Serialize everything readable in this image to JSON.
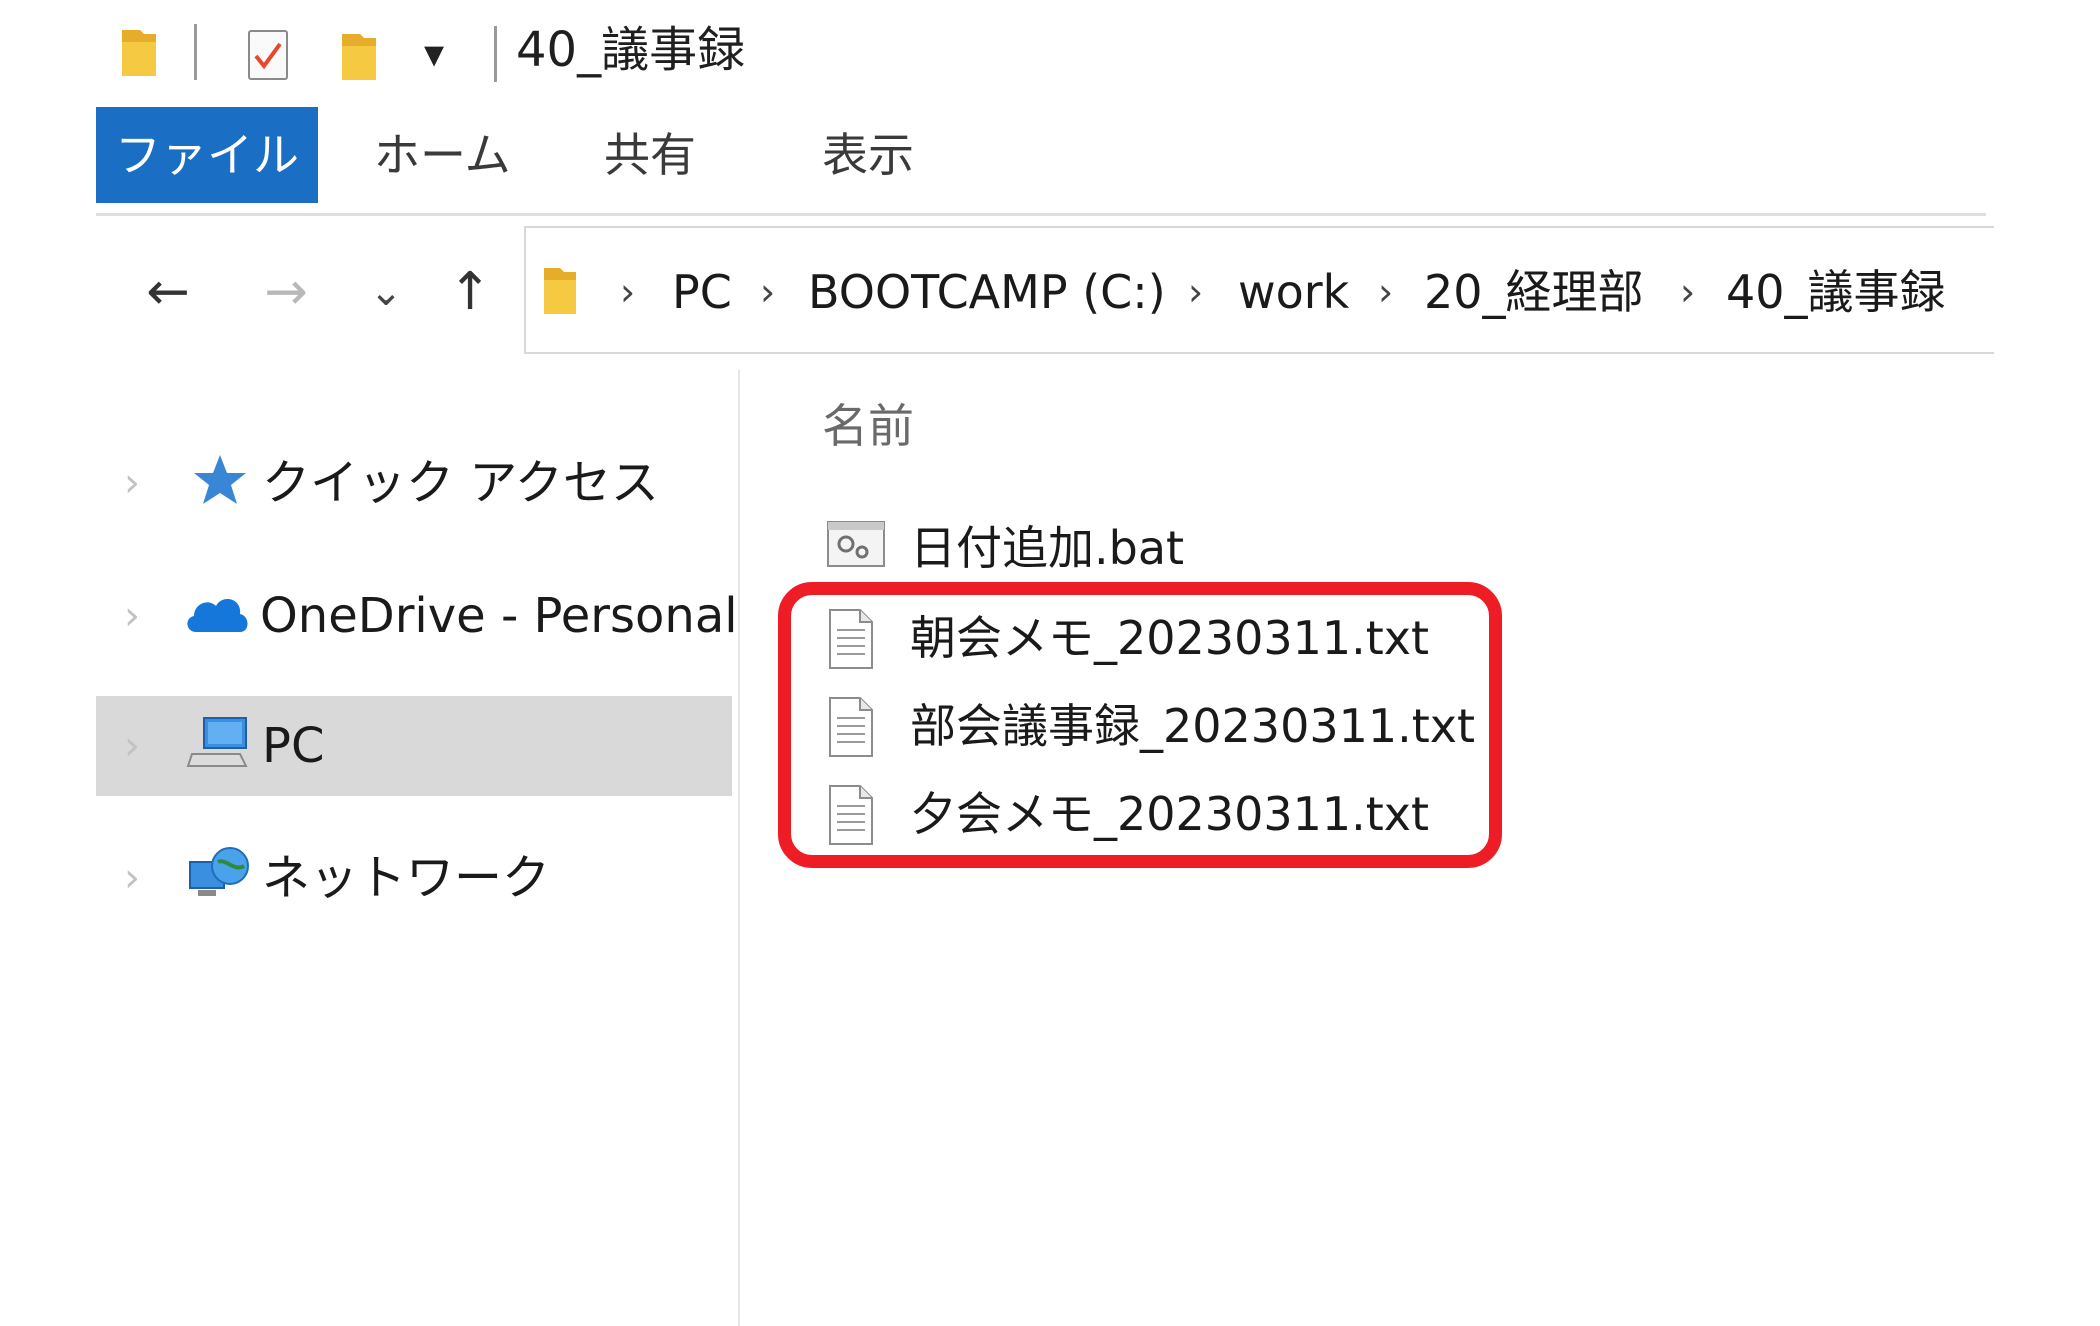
{
  "window": {
    "title": "40_議事録"
  },
  "quick_access_toolbar": {
    "icons": [
      "folder-icon",
      "properties-check-icon",
      "new-folder-icon",
      "customize-dropdown-icon"
    ],
    "dropdown_glyph": "▾"
  },
  "ribbon": {
    "tabs": [
      {
        "label": "ファイル",
        "active": true
      },
      {
        "label": "ホーム",
        "active": false
      },
      {
        "label": "共有",
        "active": false
      },
      {
        "label": "表示",
        "active": false
      }
    ]
  },
  "nav_buttons": {
    "back": "←",
    "forward": "→",
    "recent": "⌄",
    "up": "↑"
  },
  "address_bar": {
    "separator": "›",
    "path": [
      "PC",
      "BOOTCAMP (C:)",
      "work",
      "20_経理部",
      "40_議事録"
    ]
  },
  "sidebar": {
    "expander": "›",
    "items": [
      {
        "label": "クイック アクセス",
        "icon": "star-icon",
        "selected": false
      },
      {
        "label": "OneDrive - Personal",
        "icon": "cloud-icon",
        "selected": false
      },
      {
        "label": "PC",
        "icon": "computer-icon",
        "selected": true
      },
      {
        "label": "ネットワーク",
        "icon": "network-icon",
        "selected": false
      }
    ]
  },
  "file_list": {
    "column_header": "名前",
    "files": [
      {
        "name": "日付追加.bat",
        "icon": "batch-file-icon"
      },
      {
        "name": "朝会メモ_20230311.txt",
        "icon": "text-file-icon"
      },
      {
        "name": "部会議事録_20230311.txt",
        "icon": "text-file-icon"
      },
      {
        "name": "夕会メモ_20230311.txt",
        "icon": "text-file-icon"
      }
    ]
  },
  "colors": {
    "file_tab_bg": "#1a6fc4",
    "selection_bg": "#d9d9d9",
    "highlight_border": "#ee1c25",
    "folder_yellow": "#f5c942"
  }
}
